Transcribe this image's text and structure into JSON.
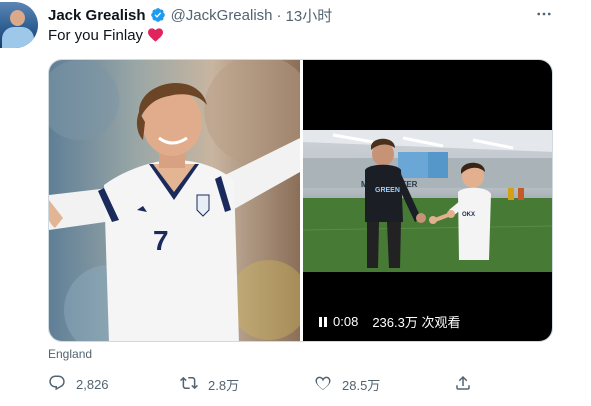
{
  "tweet": {
    "author_name": "Jack Grealish",
    "handle": "@JackGrealish",
    "separator": "·",
    "time": "13小时",
    "text": "For you Finlay",
    "location": "England"
  },
  "video": {
    "timestamp": "0:08",
    "views": "236.3万 次观看"
  },
  "actions": {
    "replies": "2,826",
    "retweets": "2.8万",
    "likes": "28.5万"
  },
  "scene_text": {
    "jersey_number": "7",
    "stadium_sign": "MANCHESTER"
  },
  "colors": {
    "verified_blue": "#1d9bf0",
    "heart_red": "#e0245e",
    "secondary_text": "#536471"
  },
  "icons": [
    "verified-badge-icon",
    "more-options-icon",
    "heart-emoji-icon",
    "pause-icon",
    "reply-icon",
    "retweet-icon",
    "like-icon",
    "share-icon"
  ]
}
